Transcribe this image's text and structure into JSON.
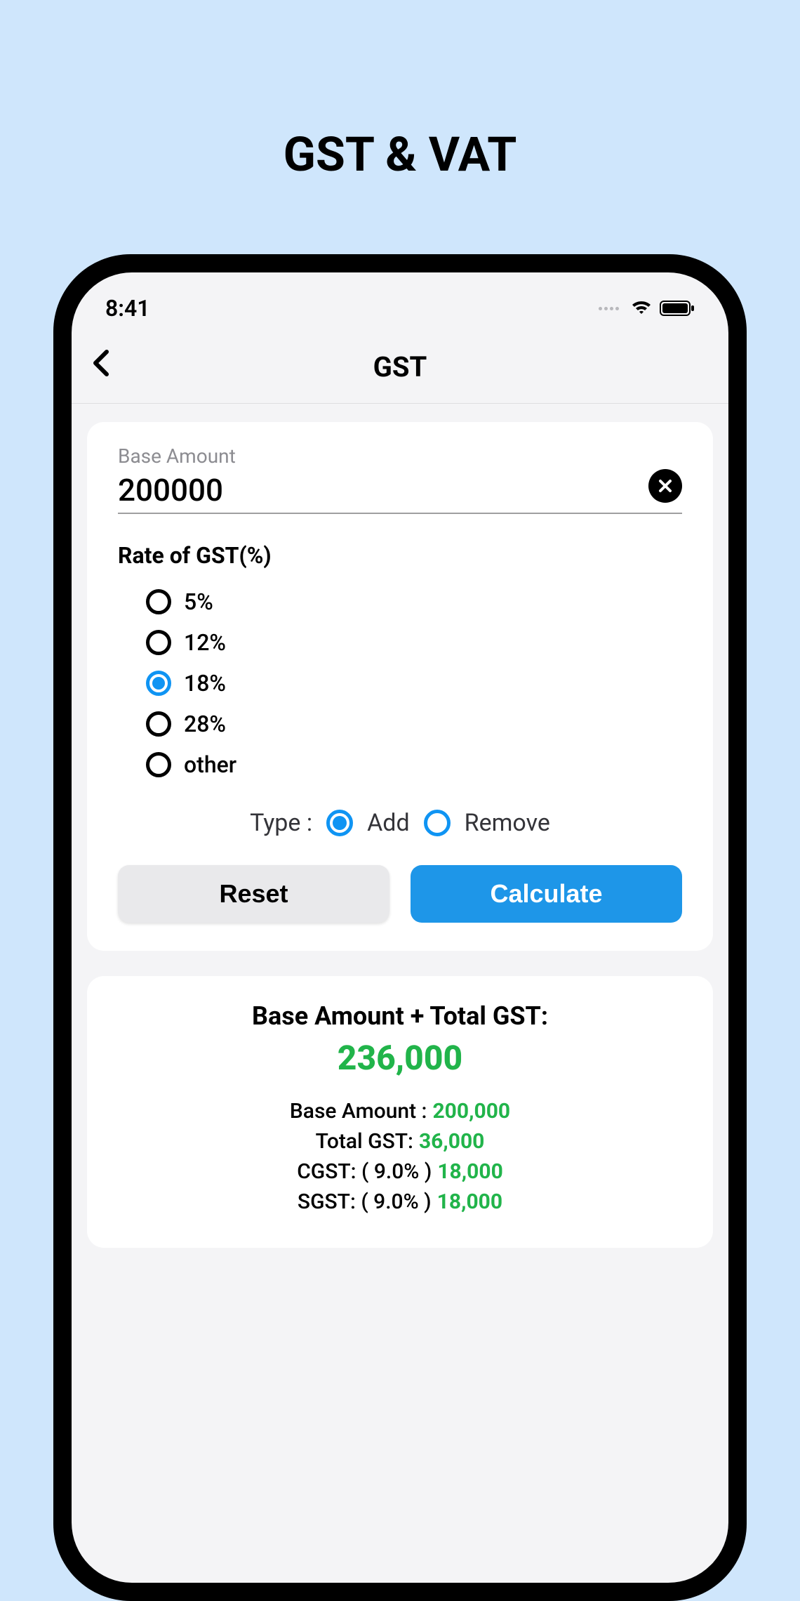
{
  "promo": {
    "title": "GST & VAT"
  },
  "status": {
    "time": "8:41"
  },
  "nav": {
    "title": "GST"
  },
  "input": {
    "label": "Base Amount",
    "value": "200000"
  },
  "rate": {
    "title": "Rate of GST(%)",
    "options": [
      "5%",
      "12%",
      "18%",
      "28%",
      "other"
    ],
    "selected_index": 2
  },
  "type": {
    "label": "Type :",
    "options": [
      "Add",
      "Remove"
    ],
    "selected_index": 0
  },
  "buttons": {
    "reset": "Reset",
    "calculate": "Calculate"
  },
  "result": {
    "title": "Base Amount + Total GST:",
    "main_value": "236,000",
    "rows": [
      {
        "label": "Base Amount :",
        "value": "200,000"
      },
      {
        "label": "Total GST:",
        "value": "36,000"
      },
      {
        "label": "CGST: ( 9.0% )",
        "value": "18,000"
      },
      {
        "label": "SGST: ( 9.0% )",
        "value": "18,000"
      }
    ]
  }
}
